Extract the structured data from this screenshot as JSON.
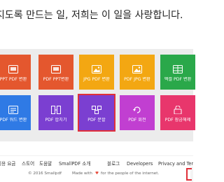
{
  "headline": {
    "text": "지도록 만드는 일, 저희는 이 일을 사랑합니다."
  },
  "tiles": [
    {
      "label": "PPT PDF 변환",
      "color": "#e4572e",
      "icon": "ppt-icon"
    },
    {
      "label": "PDF PPT변환",
      "color": "#e4572e",
      "icon": "ppt-icon"
    },
    {
      "label": "JPG PDF 변환",
      "color": "#f3a712",
      "icon": "image-icon"
    },
    {
      "label": "PDF JPG 변환",
      "color": "#f3a712",
      "icon": "image-icon"
    },
    {
      "label": "엑셀 PDF 변환",
      "color": "#2aa84a",
      "icon": "excel-icon"
    },
    {
      "label": "PDF 워드 변환",
      "color": "#2f7ae5",
      "icon": "word-icon"
    },
    {
      "label": "PDF 합치기",
      "color": "#7b3fd1",
      "icon": "merge-icon"
    },
    {
      "label": "PDF 분할",
      "color": "#7b3fd1",
      "icon": "split-icon"
    },
    {
      "label": "PDF 회전",
      "color": "#c13fd1",
      "icon": "rotate-icon"
    },
    {
      "label": "PDF 잠금해제",
      "color": "#e8366c",
      "icon": "unlock-icon"
    }
  ],
  "footer": {
    "links": [
      "이용 요금",
      "스토어",
      "도움말",
      "SmallPDF 소개",
      "블로그",
      "Developers",
      "Privacy and Terms"
    ],
    "copyright": "© 2016 Smallpdf",
    "made_with_prefix": "Made with",
    "heart": "♥",
    "made_with_suffix": "for the people of the internet."
  }
}
